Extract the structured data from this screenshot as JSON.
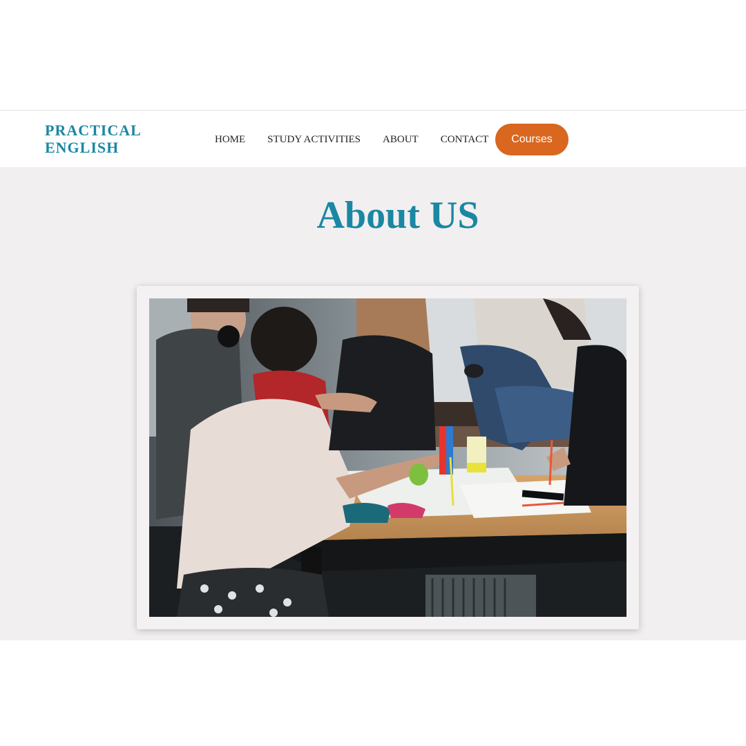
{
  "header": {
    "logo_line1": "PRACTICAL",
    "logo_line2": "ENGLISH",
    "nav": [
      {
        "label": "HOME"
      },
      {
        "label": "STUDY ACTIVITIES"
      },
      {
        "label": "ABOUT"
      },
      {
        "label": "CONTACT"
      }
    ],
    "cta_label": "Courses"
  },
  "main": {
    "title": "About US"
  },
  "colors": {
    "brand": "#1a87a3",
    "accent": "#d9671f",
    "section_bg": "#f2eff0"
  }
}
